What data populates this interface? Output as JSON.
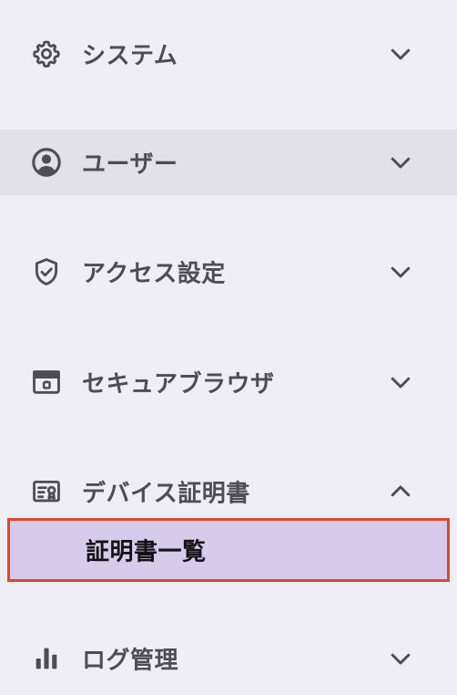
{
  "menu": {
    "system": {
      "label": "システム",
      "icon": "gear-icon",
      "expanded": false
    },
    "users": {
      "label": "ユーザー",
      "icon": "user-circle-icon",
      "expanded": false
    },
    "access": {
      "label": "アクセス設定",
      "icon": "shield-check-icon",
      "expanded": false
    },
    "browser": {
      "label": "セキュアブラウザ",
      "icon": "browser-window-icon",
      "expanded": false
    },
    "certs": {
      "label": "デバイス証明書",
      "icon": "certificate-icon",
      "expanded": true,
      "children": [
        {
          "label": "証明書一覧",
          "selected": true
        }
      ]
    },
    "logs": {
      "label": "ログ管理",
      "icon": "bar-chart-icon",
      "expanded": false
    }
  },
  "colors": {
    "background": "#efeef4",
    "hover_row": "#e2e1e7",
    "selected_bg": "#d6cbeb",
    "selected_border": "#e3452f",
    "text": "#4e4d56",
    "selected_text": "#121217"
  }
}
